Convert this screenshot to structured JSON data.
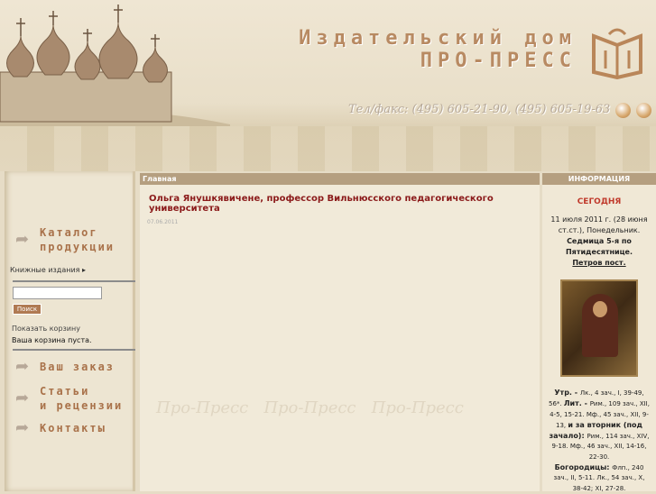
{
  "header": {
    "title_line1": "Издательский дом",
    "title_line2": "ПРО-ПРЕСС",
    "phone": "Тел/факс: (495) 605-21-90, (495) 605-19-63"
  },
  "sidebar": {
    "catalog": "Каталог продукции",
    "book_editions": "Книжные издания",
    "search_value": "",
    "search_button": "Поиск",
    "show_cart": "Показать корзину",
    "cart_empty": "Ваша корзина пуста.",
    "your_order": "Ваш заказ",
    "articles_l1": "Статьи",
    "articles_l2": "и рецензии",
    "contacts": "Контакты"
  },
  "main": {
    "breadcrumb": "Главная",
    "article_title": "Ольга Янушкявичене, профессор Вильнюсского педагогического университета",
    "article_date": "07.06.2011",
    "watermark": "Про-Пресс   Про-Пресс   Про-Пресс"
  },
  "info": {
    "header": "ИНФОРМАЦИЯ",
    "today": "СЕГОДНЯ",
    "date": "11 июля 2011 г. (28 июня ст.ст.), Понедельник.",
    "week": "Седмица 5-я по Пятидесятнице.",
    "fast": "Петров пост.",
    "readings": [
      {
        "b": "Утр. - ",
        "t": "Лк., 4 зач., I, 39-49, 56*. "
      },
      {
        "b": "Лит. - ",
        "t": "Рим., 109 зач., XII, 4-5, 15-21. Мф., 45 зач., XII, 9-13, "
      },
      {
        "b": "и за вторник (под зачало): ",
        "t": "Рим., 114 зач., XIV, 9-18. Мф., 46 зач., XII, 14-16, 22-30."
      },
      {
        "b": "Богородицы: ",
        "t": "Флп., 240 зач., II, 5-11. Лк., 54 зач., X, 38-42; XI, 27-28."
      }
    ]
  },
  "colors": {
    "accent": "#a9724a",
    "title_red": "#8b1a1a",
    "bar": "#b59f80",
    "today": "#c0392b"
  }
}
